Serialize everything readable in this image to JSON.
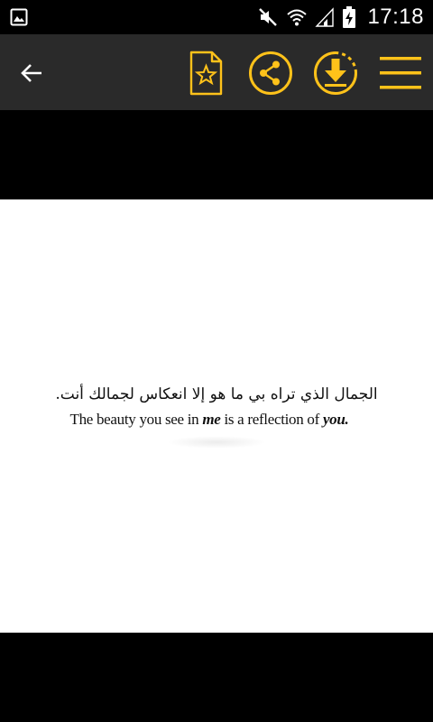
{
  "status_bar": {
    "time": "17:18",
    "icons": [
      "gallery-icon",
      "mute-icon",
      "wifi-icon",
      "signal-icon",
      "battery-charging-icon"
    ]
  },
  "app_bar": {
    "accent_color": "#FFC21A",
    "background_color": "#2A2A2A",
    "actions": [
      "back-arrow-icon",
      "favorite-document-icon",
      "share-icon",
      "download-icon",
      "menu-icon"
    ]
  },
  "quote": {
    "arabic": "الجمال الذي تراه بي ما هو إلا انعكاس لجمالك أنت.",
    "english_part1": "The beauty you see in ",
    "english_emph1": "me",
    "english_part2": " is a reflection of ",
    "english_emph2": "you."
  }
}
